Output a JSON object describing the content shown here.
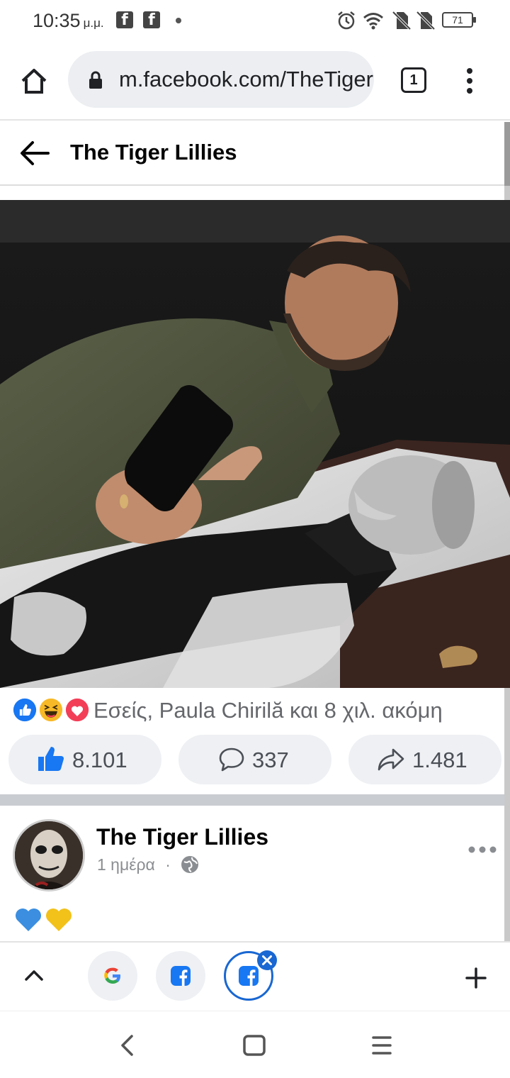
{
  "status_bar": {
    "time": "10:35",
    "ampm": "μ.μ.",
    "battery": "71"
  },
  "browser": {
    "url": "m.facebook.com/TheTiger",
    "tab_count": "1"
  },
  "page_header": {
    "title": "The Tiger Lillies"
  },
  "post1": {
    "reactions_text": "Εσείς, Paula Chirilă και 8 χιλ. ακόμη",
    "likes": "8.101",
    "comments": "337",
    "shares": "1.481"
  },
  "post2": {
    "author": "The Tiger Lillies",
    "time": "1 ημέρα",
    "separator": "·",
    "body": "💙💛"
  },
  "tab_switcher": {
    "tabs": [
      "google-tab",
      "facebook-tab",
      "facebook-tab-active"
    ]
  },
  "colors": {
    "facebook_blue": "#1877f2",
    "like_blue": "#1877f2",
    "love_red": "#f33e58",
    "haha_yellow": "#f7b928",
    "divider_gray": "#c9ccd1"
  }
}
